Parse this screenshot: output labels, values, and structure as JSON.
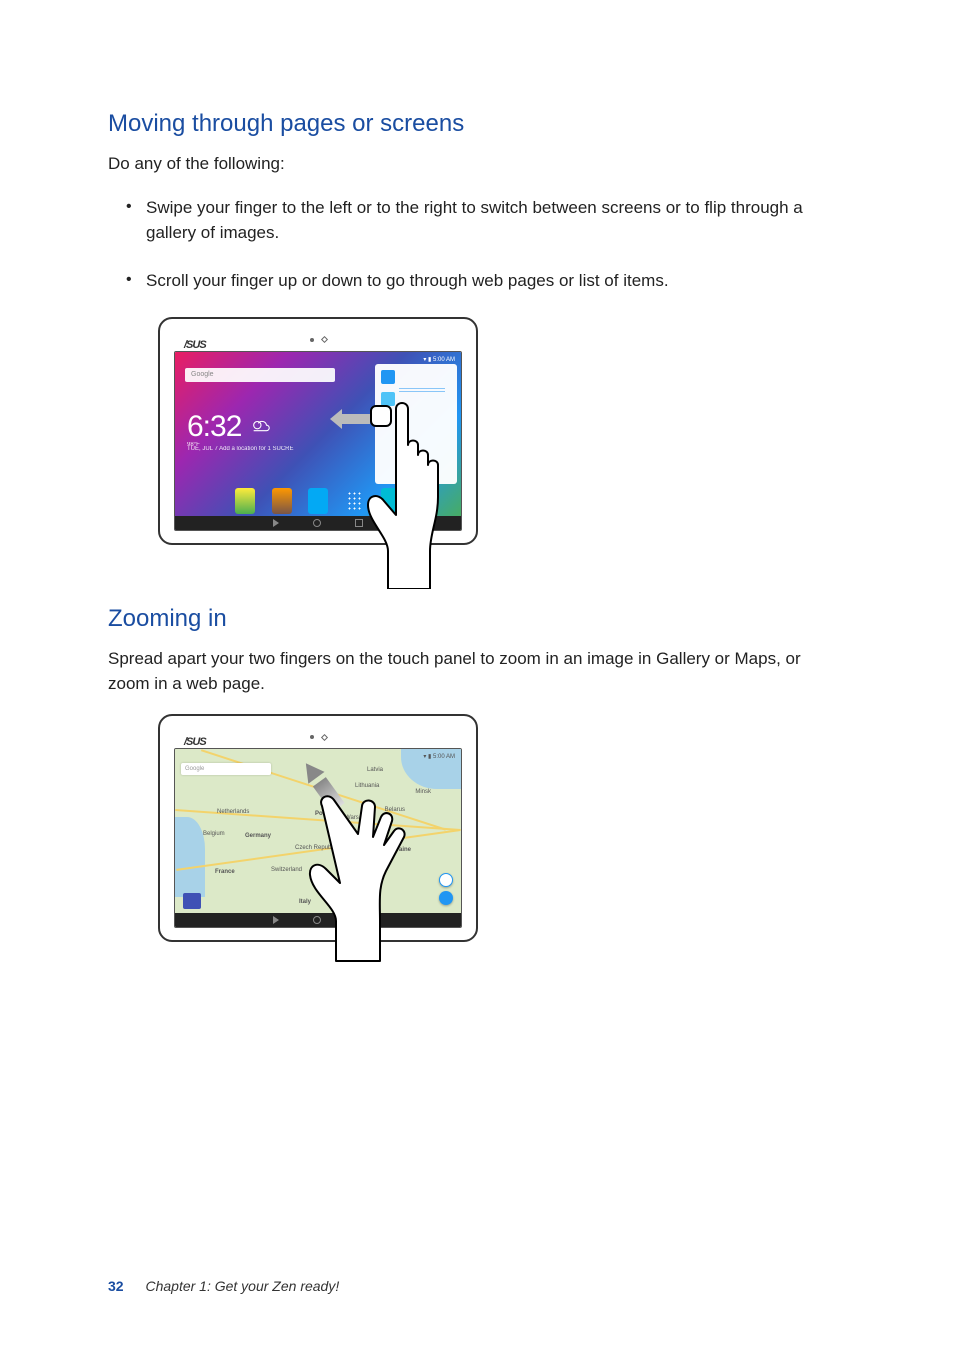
{
  "section1": {
    "heading": "Moving through pages or screens",
    "intro": "Do any of the following:",
    "bullets": [
      "Swipe your finger to the left or to the right to switch between screens or to flip through a gallery of images.",
      "Scroll your finger up or down to go through web pages or list of items."
    ]
  },
  "section2": {
    "heading": "Zooming in",
    "intro": "Spread apart your two fingers on the touch panel to zoom in an image in Gallery or Maps, or zoom in a web page."
  },
  "figure1": {
    "logo": "/SUS",
    "status_time": " 5:00 AM",
    "search_placeholder": "Google",
    "clock_time": "6:32",
    "clock_temp": "98°F",
    "clock_sub": "TUE, JUL 7  Add a location for 1 SUCRE",
    "panel_hint": "",
    "dock": [
      "",
      "",
      "Browser",
      "",
      "Camera"
    ]
  },
  "figure2": {
    "logo": "/SUS",
    "status_time": " 5:00 AM",
    "search_placeholder": "Google",
    "labels": {
      "latvia": "Latvia",
      "lithuania": "Lithuania",
      "poland": "Poland",
      "germany": "Germany",
      "france": "France",
      "ukraine": "Ukraine",
      "italy": "Italy",
      "belarus": "Belarus",
      "netherlands": "Netherlands",
      "belgium": "Belgium",
      "czech": "Czech Republic",
      "switzerland": "Switzerland",
      "minsk": "Minsk",
      "warsaw": "Warsaw"
    }
  },
  "footer": {
    "page_number": "32",
    "chapter": "Chapter 1: Get your Zen ready!"
  }
}
